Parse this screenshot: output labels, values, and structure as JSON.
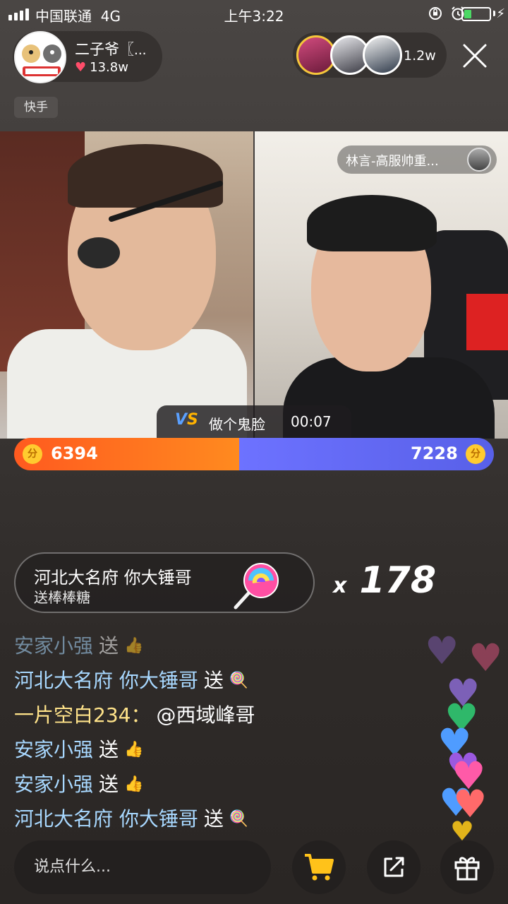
{
  "status_bar": {
    "carrier": "中国联通",
    "network": "4G",
    "time": "上午3:22",
    "battery_level": 0.3
  },
  "streamer": {
    "name": "二子爷〖...",
    "likes": "13.8w"
  },
  "viewers": {
    "count": "1.2w"
  },
  "platform_tag": "快手",
  "opponent": {
    "name": "林言-高服帅重..."
  },
  "pk": {
    "task": "做个鬼脸",
    "timer": "00:07",
    "left_score": "6394",
    "right_score": "7228",
    "left_share": 0.469,
    "coin_label": "分"
  },
  "gift_banner": {
    "user": "河北大名府 你大锤哥",
    "action": "送棒棒糖",
    "combo": "178",
    "combo_prefix": "x"
  },
  "chat": [
    {
      "user": "安家小强",
      "text": "送",
      "gift": "thumbs-up",
      "faded": true
    },
    {
      "user": "河北大名府 你大锤哥",
      "text": "送",
      "gift": "lollipop",
      "faded": false
    },
    {
      "user": "一片空白234：",
      "text": "@西域峰哥",
      "gift": "",
      "faded": false
    },
    {
      "user": "安家小强",
      "text": "送",
      "gift": "thumbs-up",
      "faded": false
    },
    {
      "user": "安家小强",
      "text": "送",
      "gift": "thumbs-up",
      "faded": false
    },
    {
      "user": "河北大名府 你大锤哥",
      "text": "送",
      "gift": "lollipop",
      "faded": false
    }
  ],
  "comment": {
    "placeholder": "说点什么..."
  },
  "colors": {
    "pk_left": "#ff6a1f",
    "pk_right": "#6a70fb",
    "chat_user": "#a8d8ff",
    "chat_user_alt": "#ffe38a"
  },
  "icons": [
    "signal-icon",
    "rotation-lock-icon",
    "alarm-icon",
    "battery-icon",
    "heart-icon",
    "close-icon",
    "vs-icon",
    "coin-icon",
    "lollipop-icon",
    "thumbs-up-icon",
    "cart-icon",
    "share-icon",
    "gift-icon"
  ]
}
